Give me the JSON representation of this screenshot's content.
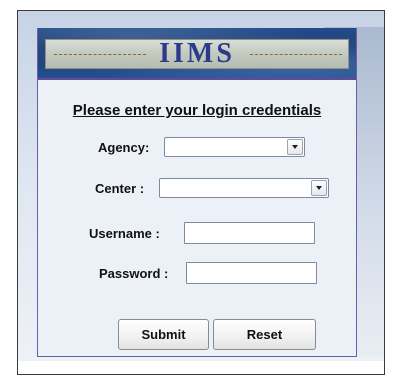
{
  "banner": {
    "title": "IIMS"
  },
  "form": {
    "heading": "Please enter your login credentials",
    "agency": {
      "label": "Agency:",
      "value": ""
    },
    "center": {
      "label": "Center :",
      "value": ""
    },
    "username": {
      "label": "Username :",
      "value": ""
    },
    "password": {
      "label": "Password :",
      "value": ""
    }
  },
  "buttons": {
    "submit_label": "Submit",
    "reset_label": "Reset"
  },
  "colors": {
    "banner_blue": "#1b3b72",
    "title_text": "#2b3b8a",
    "panel_bg": "#ecf1f8",
    "panel_border": "#6b5fa3"
  }
}
